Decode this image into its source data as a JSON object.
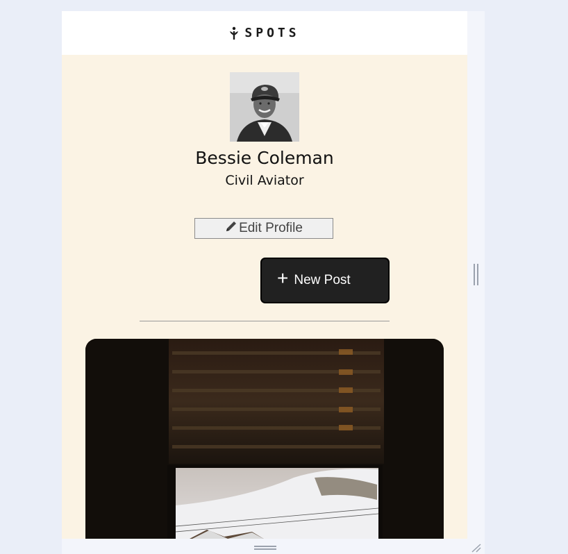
{
  "header": {
    "logo_text": "SPOTS",
    "logo_icon": "sprout-icon"
  },
  "profile": {
    "name": "Bessie Coleman",
    "description": "Civil Aviator",
    "avatar": "profile-photo",
    "edit_label": "Edit Profile",
    "edit_icon": "pencil-icon"
  },
  "actions": {
    "new_post_label": "New Post",
    "new_post_icon": "plus-icon"
  },
  "colors": {
    "page_background": "#fbf3e4",
    "header_background": "#ffffff",
    "button_dark": "#212121",
    "text": "#111111"
  }
}
